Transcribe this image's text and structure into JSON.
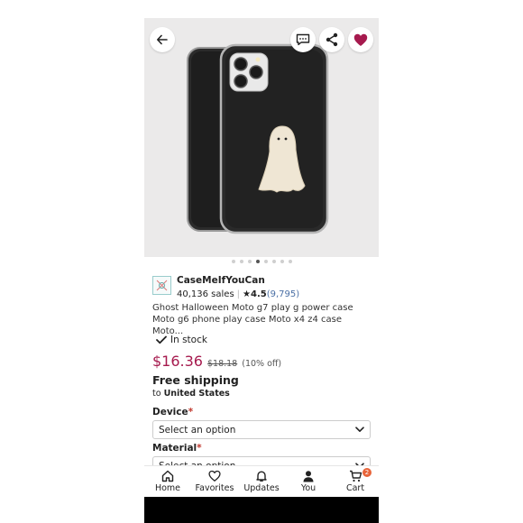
{
  "header": {
    "back_icon": "arrow-left-icon",
    "message_icon": "chat-icon",
    "share_icon": "share-icon",
    "favorite_icon": "heart-icon",
    "favorite_color": "#a61a4e"
  },
  "gallery": {
    "total": 8,
    "active_index": 3
  },
  "shop": {
    "name": "CaseMeIfYouCan",
    "sales": "40,136 sales",
    "rating": "4.5",
    "reviews": "(9,795)"
  },
  "product": {
    "title": "Ghost Halloween Moto g7 play g power case Moto g6 phone play case Moto x4 z4 case Moto...",
    "stock": "In stock",
    "price": "$16.36",
    "old_price": "$18.18",
    "discount": "(10% off)",
    "price_color": "#a61a4e"
  },
  "shipping": {
    "title": "Free shipping",
    "to_prefix": "to",
    "destination": "United States"
  },
  "options": {
    "device_label": "Device",
    "device_value": "Select an option",
    "material_label": "Material",
    "material_value": "Select an option"
  },
  "nav": {
    "home": "Home",
    "favorites": "Favorites",
    "updates": "Updates",
    "you": "You",
    "cart": "Cart",
    "cart_count": "2"
  }
}
